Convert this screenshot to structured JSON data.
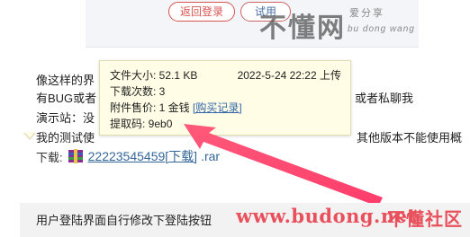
{
  "header": {
    "back_button": "返回登录",
    "use_button": "试用",
    "watermark_big": "不懂网",
    "watermark_small_cn": "爱分享",
    "watermark_small_en": "bu dong wang"
  },
  "article": {
    "line1": "像这样的界",
    "line2_left": "有BUG或者",
    "line2_right": "或者私聊我",
    "line3_left": "演示站：没",
    "line4_left": "我的测试使",
    "line4_right": "其他版本不能使用概",
    "download_label": "下载:",
    "download_link": "22223545459[下载]",
    "download_ext": ".rar",
    "bottom_text": "用户登陆界面自行修改下登陆按钮"
  },
  "popup": {
    "file_size": "文件大小: 52.1 KB",
    "upload_time": "2022-5-24 22:22 上传",
    "download_count": "下载次数: 3",
    "price_label": "附件售价: 1 金钱",
    "buy_link": "[购买记录]",
    "extract_code": "提取码: 9eb0"
  },
  "watermark_footer": {
    "url": "www.budong.net",
    "name": "不懂社区"
  },
  "colors": {
    "accent_red": "#e8505b",
    "link_blue": "#336699",
    "popup_bg": "#fffde6"
  }
}
